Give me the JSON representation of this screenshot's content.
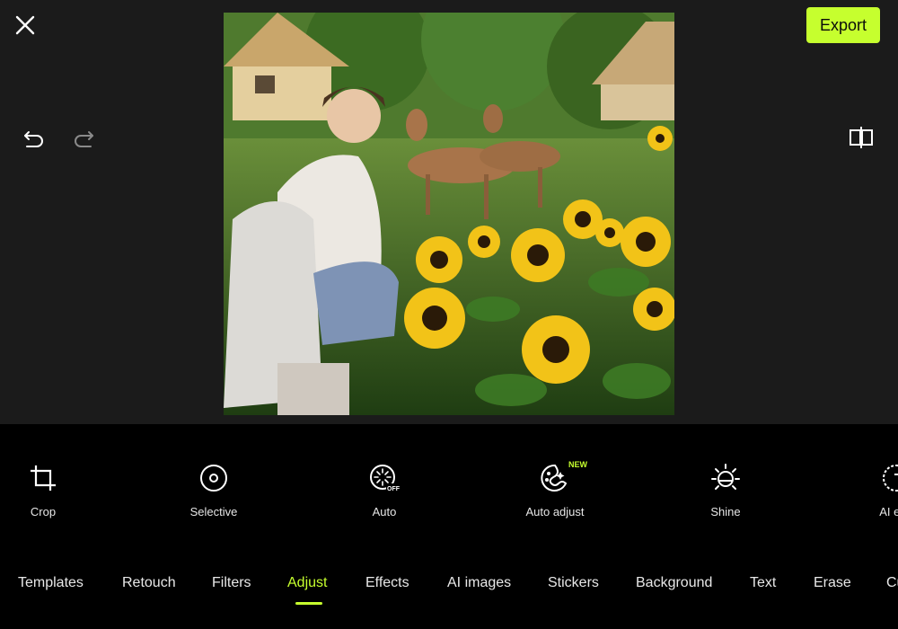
{
  "header": {
    "export_label": "Export"
  },
  "icons": {
    "close": "close-icon",
    "undo": "undo-icon",
    "redo": "redo-icon",
    "compare": "compare-icon"
  },
  "tools": [
    {
      "label": "Crop",
      "icon": "crop-icon"
    },
    {
      "label": "Selective",
      "icon": "selective-icon"
    },
    {
      "label": "Auto",
      "icon": "auto-icon"
    },
    {
      "label": "Auto adjust",
      "icon": "auto-adjust-icon",
      "badge": "NEW"
    },
    {
      "label": "Shine",
      "icon": "shine-icon"
    },
    {
      "label": "AI enh",
      "icon": "ai-enhance-icon"
    }
  ],
  "tabs": [
    {
      "label": "Templates"
    },
    {
      "label": "Retouch"
    },
    {
      "label": "Filters"
    },
    {
      "label": "Adjust",
      "active": true
    },
    {
      "label": "Effects"
    },
    {
      "label": "AI images"
    },
    {
      "label": "Stickers"
    },
    {
      "label": "Background"
    },
    {
      "label": "Text"
    },
    {
      "label": "Erase"
    },
    {
      "label": "Cu"
    }
  ],
  "colors": {
    "accent": "#c6ff2e",
    "canvas_bg": "#1b1b1b",
    "panel_bg": "#000000"
  }
}
